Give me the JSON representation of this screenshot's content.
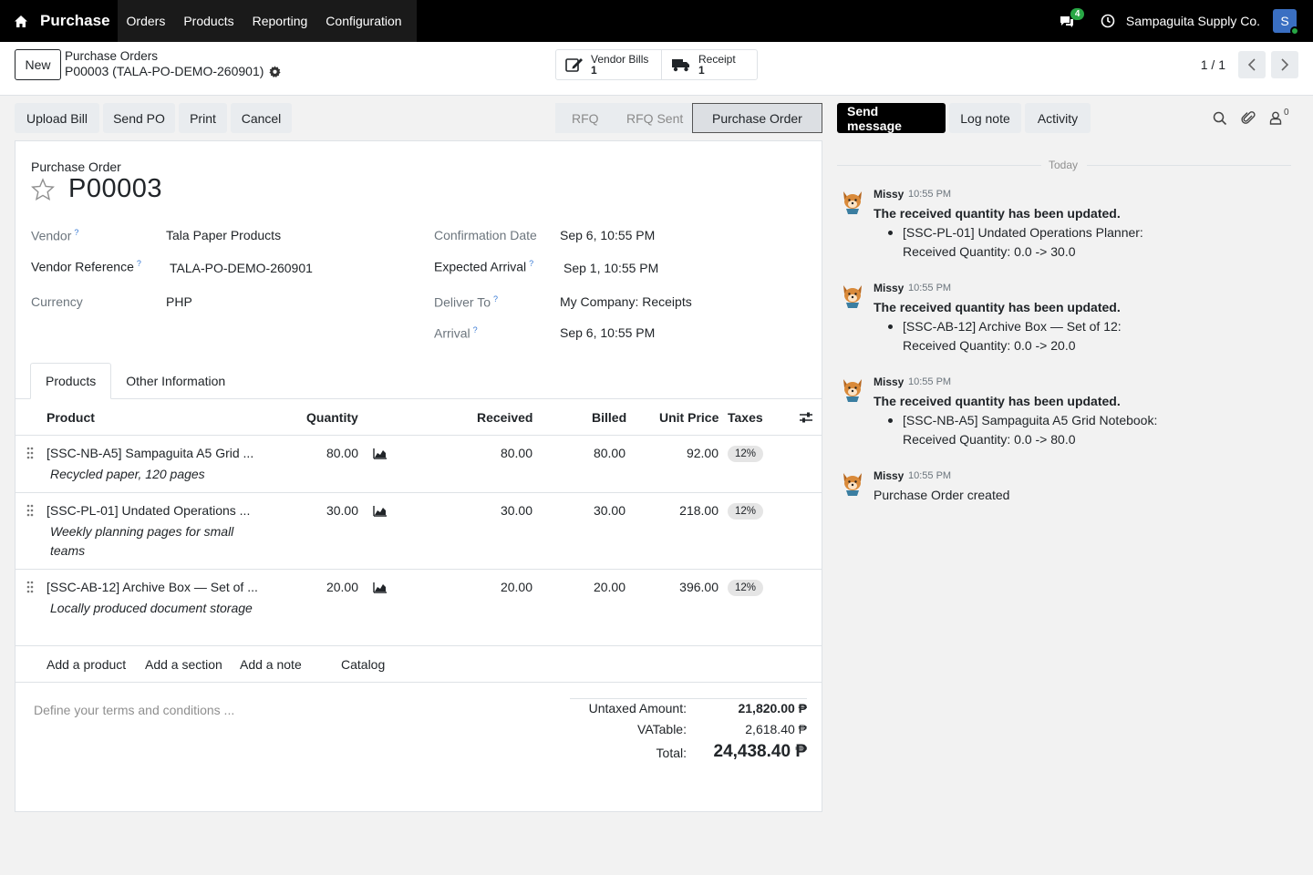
{
  "nav": {
    "app_name": "Purchase",
    "menu": [
      "Orders",
      "Products",
      "Reporting",
      "Configuration"
    ],
    "chat_count": "4",
    "company": "Sampaguita Supply Co.",
    "avatar_letter": "S"
  },
  "control": {
    "new_label": "New",
    "breadcrumb_parent": "Purchase Orders",
    "breadcrumb_current": "P00003 (TALA-PO-DEMO-260901)",
    "smart_buttons": [
      {
        "label": "Vendor Bills",
        "count": "1",
        "icon": "edit-icon"
      },
      {
        "label": "Receipt",
        "count": "1",
        "icon": "truck-icon"
      }
    ],
    "pager": "1 / 1"
  },
  "actions": [
    "Upload Bill",
    "Send PO",
    "Print",
    "Cancel"
  ],
  "statusbar": [
    "RFQ",
    "RFQ Sent",
    "Purchase Order"
  ],
  "form": {
    "type_label": "Purchase Order",
    "number": "P00003",
    "vendor_label": "Vendor",
    "vendor": "Tala Paper Products",
    "vendor_ref_label": "Vendor Reference",
    "vendor_ref": "TALA-PO-DEMO-260901",
    "currency_label": "Currency",
    "currency": "PHP",
    "confirmation_label": "Confirmation Date",
    "confirmation": "Sep 6, 10:55 PM",
    "expected_label": "Expected Arrival",
    "expected": "Sep 1, 10:55 PM",
    "deliver_label": "Deliver To",
    "deliver": "My Company: Receipts",
    "arrival_label": "Arrival",
    "arrival": "Sep 6, 10:55 PM",
    "help_mark": "?"
  },
  "tabs": [
    "Products",
    "Other Information"
  ],
  "table": {
    "headers": [
      "Product",
      "Quantity",
      "Received",
      "Billed",
      "Unit Price",
      "Taxes"
    ],
    "rows": [
      {
        "product": "[SSC-NB-A5] Sampaguita A5 Grid ...",
        "desc": "Recycled paper, 120 pages",
        "qty": "80.00",
        "received": "80.00",
        "billed": "80.00",
        "price": "92.00",
        "tax": "12%"
      },
      {
        "product": "[SSC-PL-01] Undated Operations ...",
        "desc": "Weekly planning pages for small teams",
        "qty": "30.00",
        "received": "30.00",
        "billed": "30.00",
        "price": "218.00",
        "tax": "12%"
      },
      {
        "product": "[SSC-AB-12] Archive Box — Set of ...",
        "desc": "Locally produced document storage",
        "qty": "20.00",
        "received": "20.00",
        "billed": "20.00",
        "price": "396.00",
        "tax": "12%"
      }
    ],
    "add_links": [
      "Add a product",
      "Add a section",
      "Add a note",
      "Catalog"
    ]
  },
  "terms_placeholder": "Define your terms and conditions ...",
  "totals": {
    "untaxed_label": "Untaxed Amount:",
    "untaxed": "21,820.00 ₱",
    "vat_label": "VATable:",
    "vat": "2,618.40 ₱",
    "total_label": "Total:",
    "total": "24,438.40 ₱"
  },
  "chatter": {
    "send_message": "Send message",
    "log_note": "Log note",
    "activity": "Activity",
    "follower_count": "0",
    "today": "Today",
    "messages": [
      {
        "author": "Missy",
        "time": "10:55 PM",
        "title": "The received quantity has been updated.",
        "line1": "[SSC-PL-01] Undated Operations Planner:",
        "line2": "Received Quantity: 0.0 -> 30.0"
      },
      {
        "author": "Missy",
        "time": "10:55 PM",
        "title": "The received quantity has been updated.",
        "line1": "[SSC-AB-12] Archive Box — Set of 12:",
        "line2": "Received Quantity: 0.0 -> 20.0"
      },
      {
        "author": "Missy",
        "time": "10:55 PM",
        "title": "The received quantity has been updated.",
        "line1": "[SSC-NB-A5] Sampaguita A5 Grid Notebook:",
        "line2": "Received Quantity: 0.0 -> 80.0"
      },
      {
        "author": "Missy",
        "time": "10:55 PM",
        "text": "Purchase Order created"
      }
    ]
  }
}
